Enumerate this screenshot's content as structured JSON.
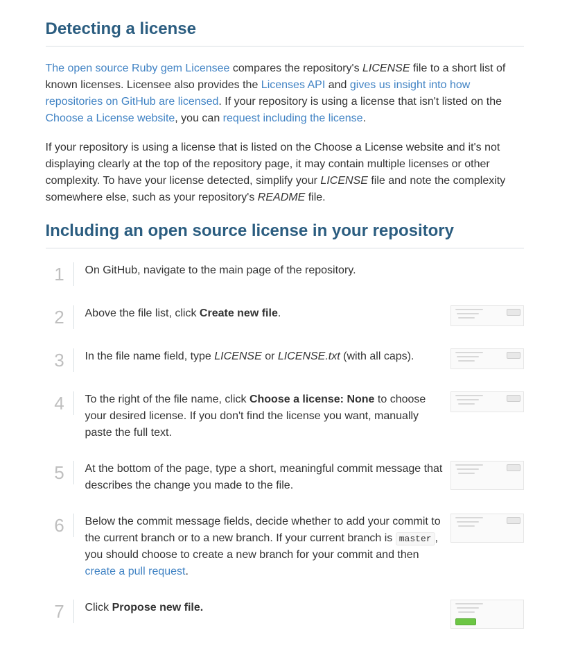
{
  "section1": {
    "heading": "Detecting a license",
    "p1": {
      "link1": "The open source Ruby gem Licensee",
      "t1": " compares the repository's ",
      "em1": "LICENSE",
      "t2": " file to a short list of known licenses. Licensee also provides the ",
      "link2": "Licenses API",
      "t3": " and ",
      "link3": "gives us insight into how repositories on GitHub are licensed",
      "t4": ". If your repository is using a license that isn't listed on the ",
      "link4": "Choose a License website",
      "t5": ", you can ",
      "link5": "request including the license",
      "t6": "."
    },
    "p2": {
      "t1": "If your repository is using a license that is listed on the Choose a License website and it's not displaying clearly at the top of the repository page, it may contain multiple licenses or other complexity. To have your license detected, simplify your ",
      "em1": "LICENSE",
      "t2": " file and note the complexity somewhere else, such as your repository's ",
      "em2": "README",
      "t3": " file."
    }
  },
  "section2": {
    "heading": "Including an open source license in your repository",
    "steps": [
      {
        "n": "1",
        "html": [
          [
            "text",
            "On GitHub, navigate to the main page of the repository."
          ]
        ],
        "img": false
      },
      {
        "n": "2",
        "html": [
          [
            "text",
            "Above the file list, click "
          ],
          [
            "b",
            "Create new file"
          ],
          [
            "text",
            "."
          ]
        ],
        "img": true
      },
      {
        "n": "3",
        "html": [
          [
            "text",
            "In the file name field, type "
          ],
          [
            "em",
            "LICENSE"
          ],
          [
            "text",
            " or "
          ],
          [
            "em",
            "LICENSE.txt"
          ],
          [
            "text",
            " (with all caps)."
          ]
        ],
        "img": true
      },
      {
        "n": "4",
        "html": [
          [
            "text",
            "To the right of the file name, click "
          ],
          [
            "b",
            "Choose a license: None"
          ],
          [
            "text",
            " to choose your desired license. If you don't find the license you want, manually paste the full text."
          ]
        ],
        "img": true
      },
      {
        "n": "5",
        "html": [
          [
            "text",
            "At the bottom of the page, type a short, meaningful commit message that describes the change you made to the file."
          ]
        ],
        "img": true,
        "tall": true
      },
      {
        "n": "6",
        "html": [
          [
            "text",
            "Below the commit message fields, decide whether to add your commit to the current branch or to a new branch. If your current branch is "
          ],
          [
            "code",
            "master"
          ],
          [
            "text",
            ", you should choose to create a new branch for your commit and then "
          ],
          [
            "link",
            "create a pull request"
          ],
          [
            "text",
            "."
          ]
        ],
        "img": true,
        "tall": true
      },
      {
        "n": "7",
        "html": [
          [
            "text",
            "Click "
          ],
          [
            "b",
            "Propose new file."
          ]
        ],
        "img": true,
        "tall": true,
        "green": true
      }
    ]
  }
}
